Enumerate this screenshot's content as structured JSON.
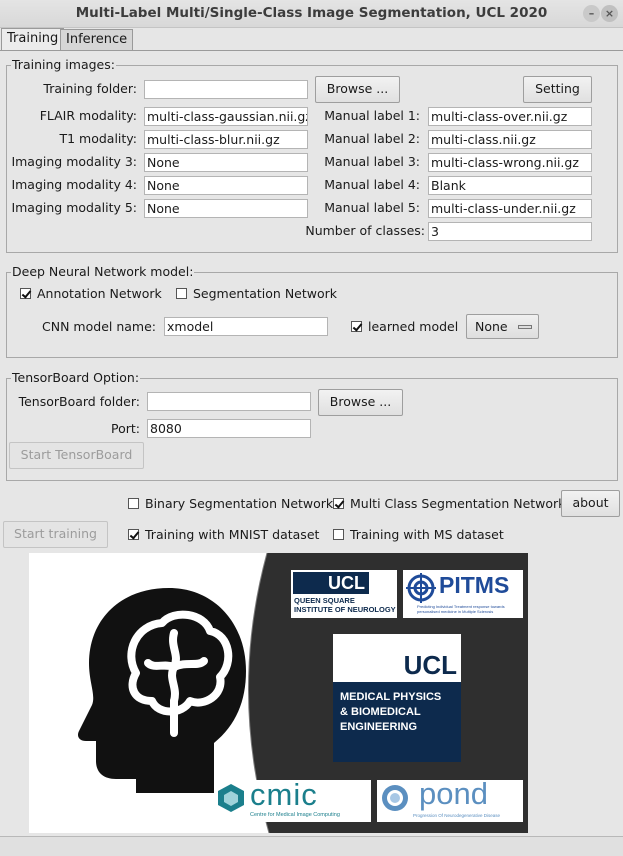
{
  "window": {
    "title": "Multi-Label Multi/Single-Class Image Segmentation, UCL 2020"
  },
  "tabs": [
    {
      "label": "Training"
    },
    {
      "label": "Inference"
    }
  ],
  "training_images": {
    "legend": "Training images:",
    "training_folder_label": "Training folder:",
    "training_folder_value": "",
    "browse_label": "Browse ...",
    "setting_label": "Setting",
    "modalities": [
      {
        "label": "FLAIR modality:",
        "value": "multi-class-gaussian.nii.gz"
      },
      {
        "label": "T1 modality:",
        "value": "multi-class-blur.nii.gz"
      },
      {
        "label": "Imaging modality 3:",
        "value": "None"
      },
      {
        "label": "Imaging modality 4:",
        "value": "None"
      },
      {
        "label": "Imaging modality 5:",
        "value": "None"
      }
    ],
    "manual_labels": [
      {
        "label": "Manual label 1:",
        "value": "multi-class-over.nii.gz"
      },
      {
        "label": "Manual label 2:",
        "value": "multi-class.nii.gz"
      },
      {
        "label": "Manual label 3:",
        "value": "multi-class-wrong.nii.gz"
      },
      {
        "label": "Manual label 4:",
        "value": "Blank"
      },
      {
        "label": "Manual label 5:",
        "value": "multi-class-under.nii.gz"
      }
    ],
    "num_classes_label": "Number of classes:",
    "num_classes_value": "3"
  },
  "dnn_model": {
    "legend": "Deep Neural Network model:",
    "annotation_network": {
      "label": "Annotation Network",
      "checked": true
    },
    "segmentation_network": {
      "label": "Segmentation Network",
      "checked": false
    },
    "cnn_model_name_label": "CNN model name:",
    "cnn_model_name_value": "xmodel",
    "learned_model": {
      "label": "learned model",
      "checked": true
    },
    "model_select": "None"
  },
  "tensorboard": {
    "legend": "TensorBoard Option:",
    "folder_label": "TensorBoard folder:",
    "folder_value": "",
    "browse_label": "Browse ...",
    "port_label": "Port:",
    "port_value": "8080",
    "start_label": "Start TensorBoard"
  },
  "bottom": {
    "binary_seg": {
      "label": "Binary Segmentation Network",
      "checked": false
    },
    "multi_class_seg": {
      "label": "Multi Class Segmentation Network",
      "checked": true
    },
    "about_label": "about",
    "start_training_label": "Start training",
    "mnist": {
      "label": "Training with MNIST dataset",
      "checked": true
    },
    "ms": {
      "label": "Training with MS dataset",
      "checked": false
    }
  },
  "logos": {
    "ucl_qs": {
      "brand": "UCL",
      "line1": "QUEEN SQUARE",
      "line2": "INSTITUTE OF NEUROLOGY"
    },
    "pitms": {
      "brand": "PITMS",
      "tagline": "Predicting Individual Treatment response towards personalised medicine in Multiple Sclerosis"
    },
    "ucl_mpbe": {
      "brand": "UCL",
      "line1": "MEDICAL PHYSICS",
      "line2": "& BIOMEDICAL",
      "line3": "ENGINEERING"
    },
    "cmic": {
      "brand": "cmic",
      "tagline": "Centre for Medical Image Computing"
    },
    "pond": {
      "brand": "pond",
      "tagline": "Progression Of Neurodegenerative Disease"
    }
  },
  "colors": {
    "ucl_purple": "#5a2d82",
    "ucl_navy": "#0d2a4d",
    "pitms_blue": "#1f4b99",
    "cmic_teal": "#1b7f8c"
  }
}
